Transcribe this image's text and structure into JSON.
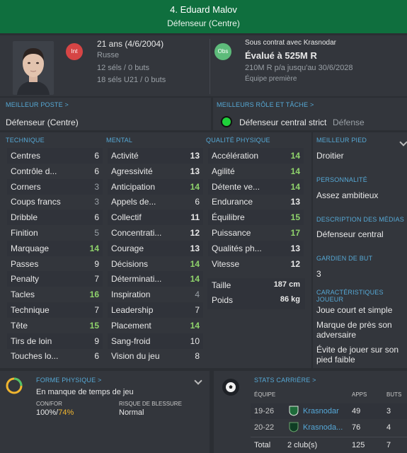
{
  "header": {
    "title": "4. Eduard Malov",
    "position": "Défenseur (Centre)"
  },
  "info": {
    "age": "21 ans (4/6/2004)",
    "nationality": "Russe",
    "caps": "12 séls / 0 buts",
    "u21_caps": "18 séls U21 / 0 buts",
    "int_badge": "Int",
    "obs_badge": "Obs"
  },
  "contract": {
    "status": "Sous contrat avec Krasnodar",
    "valuation": "Évalué à 525M R",
    "wage": "210M R p/a jusqu'au 30/6/2028",
    "squad": "Équipe première"
  },
  "best_position": {
    "title": "MEILLEUR POSTE >",
    "value": "Défenseur (Centre)"
  },
  "best_role": {
    "title": "MEILLEURS RÔLE ET TÂCHE >",
    "role": "Défenseur central strict",
    "duty": "Défense"
  },
  "technique": {
    "title": "TECHNIQUE",
    "attrs": [
      {
        "label": "Centres",
        "value": "6"
      },
      {
        "label": "Contrôle d...",
        "value": "6"
      },
      {
        "label": "Corners",
        "value": "3"
      },
      {
        "label": "Coups francs",
        "value": "3"
      },
      {
        "label": "Dribble",
        "value": "6"
      },
      {
        "label": "Finition",
        "value": "5"
      },
      {
        "label": "Marquage",
        "value": "14"
      },
      {
        "label": "Passes",
        "value": "9"
      },
      {
        "label": "Penalty",
        "value": "7"
      },
      {
        "label": "Tacles",
        "value": "16"
      },
      {
        "label": "Technique",
        "value": "7"
      },
      {
        "label": "Tête",
        "value": "15"
      },
      {
        "label": "Tirs de loin",
        "value": "9"
      },
      {
        "label": "Touches lo...",
        "value": "6"
      }
    ]
  },
  "mental": {
    "title": "MENTAL",
    "attrs": [
      {
        "label": "Activité",
        "value": "13"
      },
      {
        "label": "Agressivité",
        "value": "13"
      },
      {
        "label": "Anticipation",
        "value": "14"
      },
      {
        "label": "Appels de...",
        "value": "6"
      },
      {
        "label": "Collectif",
        "value": "11"
      },
      {
        "label": "Concentrati...",
        "value": "12"
      },
      {
        "label": "Courage",
        "value": "13"
      },
      {
        "label": "Décisions",
        "value": "14"
      },
      {
        "label": "Déterminati...",
        "value": "14"
      },
      {
        "label": "Inspiration",
        "value": "4"
      },
      {
        "label": "Leadership",
        "value": "7"
      },
      {
        "label": "Placement",
        "value": "14"
      },
      {
        "label": "Sang-froid",
        "value": "10"
      },
      {
        "label": "Vision du jeu",
        "value": "8"
      }
    ]
  },
  "physical": {
    "title": "QUALITÉ PHYSIQUE",
    "attrs": [
      {
        "label": "Accélération",
        "value": "14"
      },
      {
        "label": "Agilité",
        "value": "14"
      },
      {
        "label": "Détente ve...",
        "value": "14"
      },
      {
        "label": "Endurance",
        "value": "13"
      },
      {
        "label": "Équilibre",
        "value": "15"
      },
      {
        "label": "Puissance",
        "value": "17"
      },
      {
        "label": "Qualités ph...",
        "value": "13"
      },
      {
        "label": "Vitesse",
        "value": "12"
      }
    ],
    "height_label": "Taille",
    "height": "187 cm",
    "weight_label": "Poids",
    "weight": "86 kg"
  },
  "side": {
    "foot_title": "MEILLEUR PIED",
    "foot": "Droitier",
    "personality_title": "PERSONNALITÉ",
    "personality": "Assez ambitieux",
    "media_title": "DESCRIPTION DES MÉDIAS",
    "media": "Défenseur central",
    "gk_title": "GARDIEN DE BUT",
    "gk": "3",
    "traits_title": "CARACTÉRISTIQUES JOUEUR",
    "traits": [
      "Joue court et simple",
      "Marque de près son adversaire",
      "Évite de jouer sur son pied faible"
    ]
  },
  "fitness": {
    "title": "FORME PHYSIQUE >",
    "status": "En manque de temps de jeu",
    "confor_label": "CON/FOR",
    "confor_a": "100%/",
    "confor_b": "74%",
    "injury_label": "RISQUE DE BLESSURE",
    "injury": "Normal"
  },
  "career": {
    "title": "STATS CARRIÈRE >",
    "col_team": "ÉQUIPE",
    "col_apps": "APPS",
    "col_goals": "BUTS",
    "rows": [
      {
        "season": "19-26",
        "team": "Krasnodar",
        "apps": "49",
        "goals": "3"
      },
      {
        "season": "20-22",
        "team": "Krasnoda...",
        "apps": "76",
        "goals": "4"
      }
    ],
    "total_label": "Total",
    "total_clubs": "2 club(s)",
    "total_apps": "125",
    "total_goals": "7"
  },
  "colors": {
    "header": "#0f6f3e",
    "accent": "#55a8d8",
    "good": "#8fd36b",
    "int_badge": "#d64545",
    "obs_badge": "#5dbb7a"
  }
}
